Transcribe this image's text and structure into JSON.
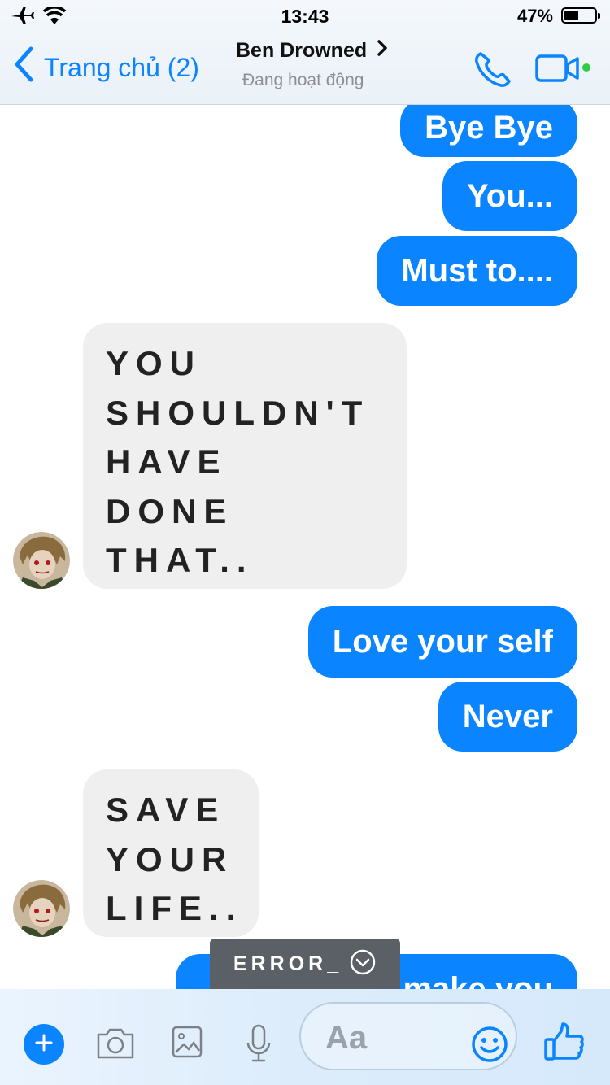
{
  "status_bar": {
    "time": "13:43",
    "battery_text": "47%",
    "battery_level": 0.47
  },
  "header": {
    "back_label": "Trang chủ (2)",
    "contact_name": "Ben Drowned",
    "contact_status": "Đang hoạt động",
    "accent_color": "#0a84ff",
    "online_color": "#31cc46"
  },
  "messages": [
    {
      "from": "me",
      "text": "Bye Bye"
    },
    {
      "from": "me",
      "text": "You..."
    },
    {
      "from": "me",
      "text": "Must to...."
    },
    {
      "from": "them",
      "lines": [
        "YOU",
        "SHOULDN'T",
        "HAVE",
        "DONE",
        "THAT.."
      ]
    },
    {
      "from": "me",
      "text": "Love your self"
    },
    {
      "from": "me",
      "text": "Never"
    },
    {
      "from": "them",
      "lines": [
        "SAVE",
        "YOUR",
        "LIFE.."
      ]
    },
    {
      "from": "me",
      "text": "make you"
    }
  ],
  "overlay": {
    "error_label": "ERROR_"
  },
  "composer": {
    "placeholder": "Aa",
    "icons": [
      "plus-icon",
      "camera-icon",
      "image-icon",
      "microphone-icon",
      "emoji-icon",
      "thumbs-up-icon"
    ]
  }
}
